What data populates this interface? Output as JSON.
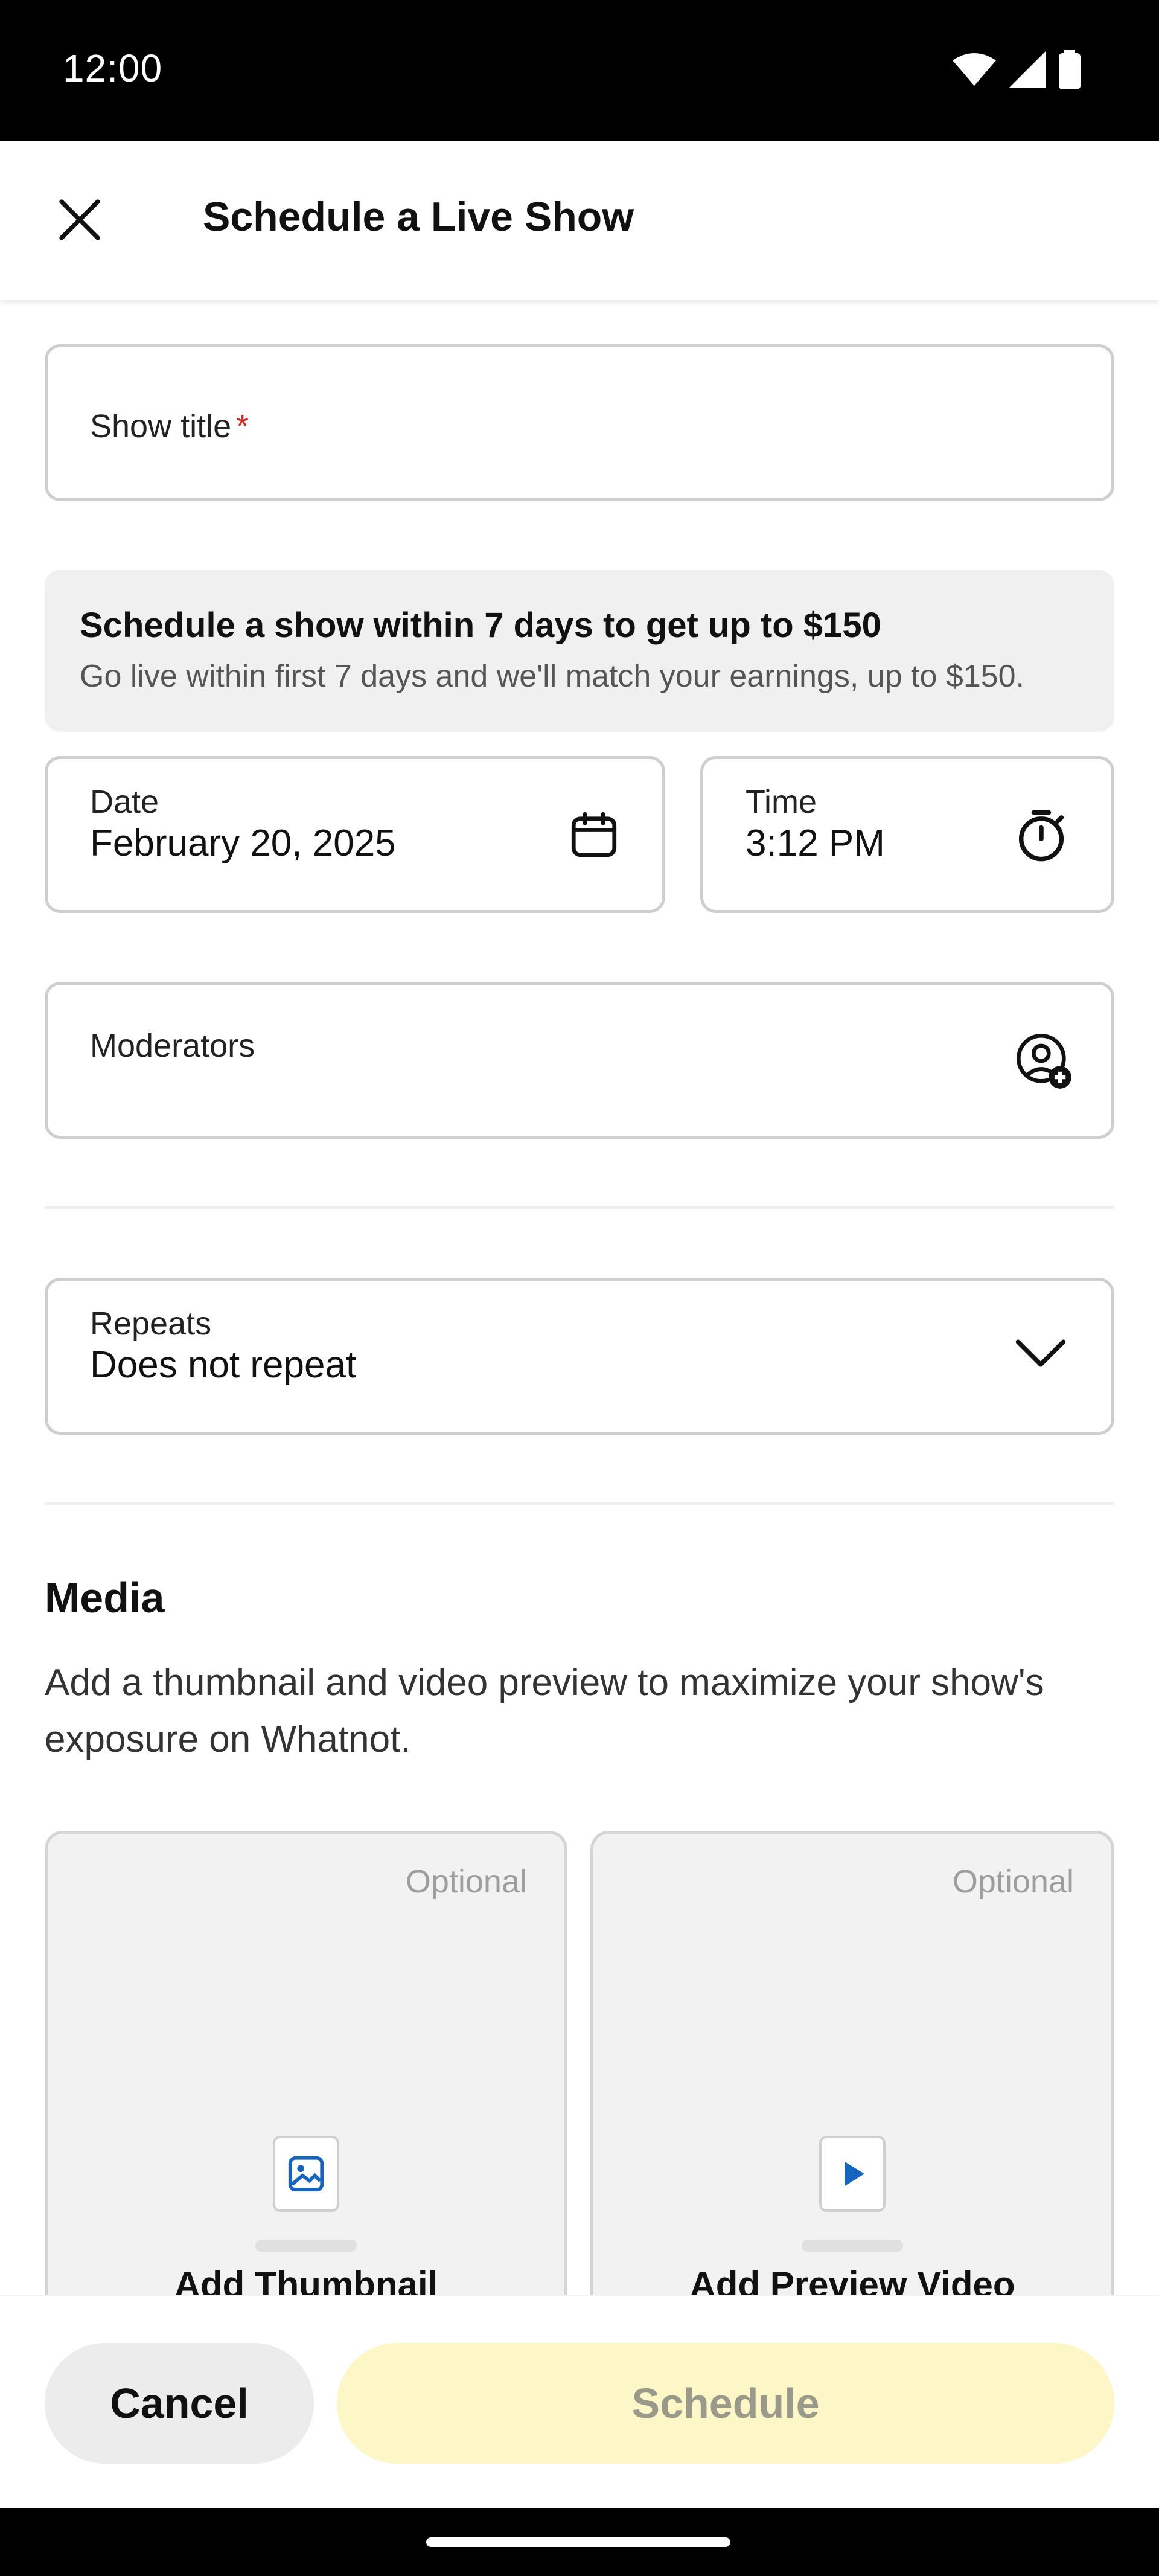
{
  "status_bar": {
    "time": "12:00"
  },
  "header": {
    "title": "Schedule a Live Show"
  },
  "form": {
    "show_title": {
      "label": "Show title",
      "required_mark": "*"
    },
    "promo": {
      "headline": "Schedule a show within 7 days to get up to $150",
      "subtext": "Go live within first 7 days and we'll match your earnings, up to $150."
    },
    "date": {
      "label": "Date",
      "value": "February 20, 2025"
    },
    "time": {
      "label": "Time",
      "value": "3:12 PM"
    },
    "moderators": {
      "label": "Moderators"
    },
    "repeats": {
      "label": "Repeats",
      "value": "Does not repeat"
    }
  },
  "media": {
    "title": "Media",
    "description": "Add a thumbnail and video preview to maximize your show's exposure on Whatnot.",
    "cards": [
      {
        "badge": "Optional",
        "label": "Add Thumbnail"
      },
      {
        "badge": "Optional",
        "label": "Add Preview Video"
      }
    ]
  },
  "actions": {
    "cancel": "Cancel",
    "schedule": "Schedule"
  },
  "colors": {
    "schedule_bg": "#fdf6c7",
    "required": "#dd2222",
    "play_icon": "#1565c0"
  }
}
